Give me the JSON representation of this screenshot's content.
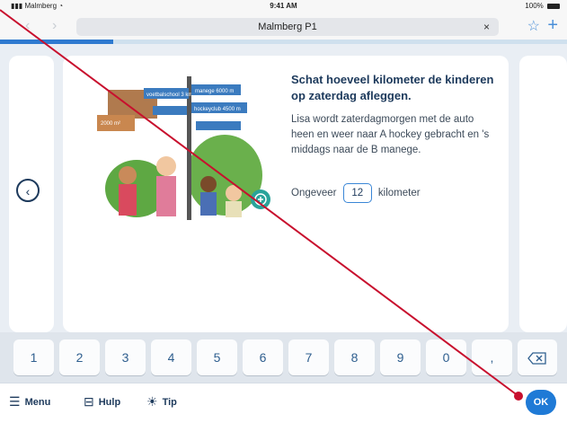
{
  "status_bar": {
    "carrier": "Malmberg",
    "time": "9:41 AM",
    "battery": "100%"
  },
  "browser": {
    "url_title": "Malmberg P1",
    "close": "×",
    "star": "☆",
    "plus": "+",
    "back_arrow": "‹",
    "forward_arrow": "›"
  },
  "progress_fraction": 0.2,
  "exercise": {
    "title": "Schat hoeveel kilometer de kinderen op zaterdag afleggen.",
    "description": "Lisa wordt zaterdagmorgen met de auto heen en weer naar A hockey gebracht en 's middags naar de B manege.",
    "answer_prefix": "Ongeveer",
    "answer_value": "12",
    "answer_suffix": "kilometer",
    "illustration_signs": [
      "manege 6000 m",
      "voetbalschool 3 km",
      "hockeyclub 4500 m",
      "2000 m²"
    ]
  },
  "keypad": [
    "1",
    "2",
    "3",
    "4",
    "5",
    "6",
    "7",
    "8",
    "9",
    "0",
    ","
  ],
  "toolbar": {
    "menu": "Menu",
    "help": "Hulp",
    "tip": "Tip",
    "ok": "OK"
  },
  "icons": {
    "back": "chevron-left-icon",
    "zoom": "zoom-plus-icon",
    "backspace": "backspace-icon"
  },
  "colors": {
    "accent": "#1f7ad6",
    "text": "#1d3a5c",
    "annotation": "#c8102e"
  }
}
